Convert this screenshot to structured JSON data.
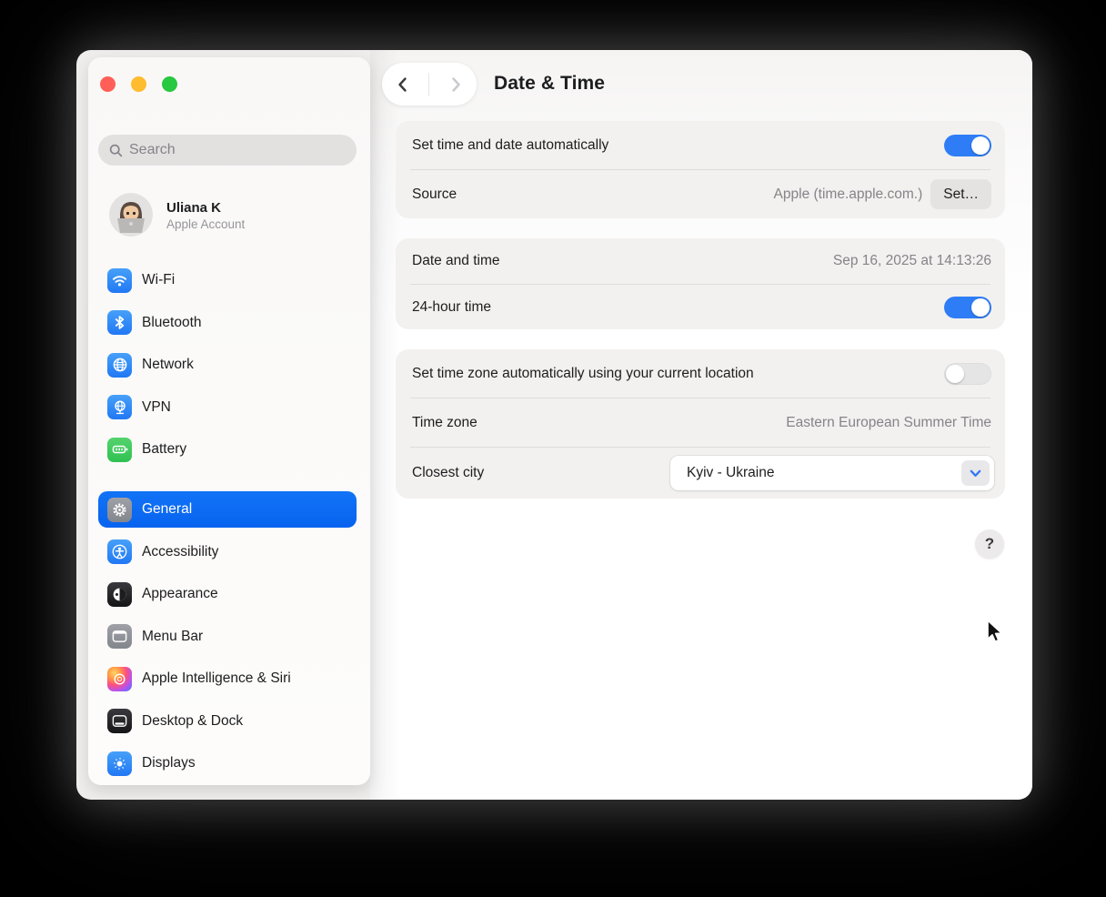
{
  "window": {
    "title": "Date & Time",
    "traffic_lights": [
      "close",
      "minimize",
      "zoom"
    ]
  },
  "sidebar": {
    "search": {
      "placeholder": "Search"
    },
    "profile": {
      "name": "Uliana K",
      "subtitle": "Apple Account"
    },
    "nav_primary": [
      {
        "label": "Wi-Fi",
        "icon": "wifi-icon",
        "color": "#2e86f6"
      },
      {
        "label": "Bluetooth",
        "icon": "bluetooth-icon",
        "color": "#2e86f6"
      },
      {
        "label": "Network",
        "icon": "network-icon",
        "color": "#2e86f6"
      },
      {
        "label": "VPN",
        "icon": "vpn-icon",
        "color": "#2e86f6"
      },
      {
        "label": "Battery",
        "icon": "battery-icon",
        "color": "#34c759"
      }
    ],
    "nav_secondary": [
      {
        "label": "General",
        "icon": "gear-icon",
        "color": "#8e8e93",
        "selected": true
      },
      {
        "label": "Accessibility",
        "icon": "accessibility-icon",
        "color": "#2e86f6",
        "selected": false
      },
      {
        "label": "Appearance",
        "icon": "appearance-icon",
        "color": "#1c1c1e",
        "selected": false
      },
      {
        "label": "Menu Bar",
        "icon": "menu-bar-icon",
        "color": "#8e8e93",
        "selected": false
      },
      {
        "label": "Apple Intelligence & Siri",
        "icon": "apple-intelligence-icon",
        "color": "gradient",
        "selected": false
      },
      {
        "label": "Desktop & Dock",
        "icon": "desktop-dock-icon",
        "color": "#1c1c1e",
        "selected": false
      },
      {
        "label": "Displays",
        "icon": "displays-icon",
        "color": "#2e86f6",
        "selected": false
      }
    ]
  },
  "content": {
    "groups": [
      {
        "rows": [
          {
            "label": "Set time and date automatically",
            "control": "toggle",
            "value": true
          },
          {
            "label": "Source",
            "value_text": "Apple (time.apple.com.)",
            "button_label": "Set…"
          }
        ]
      },
      {
        "rows": [
          {
            "label": "Date and time",
            "value_text": "Sep 16, 2025 at 14:13:26"
          },
          {
            "label": "24-hour time",
            "control": "toggle",
            "value": true
          }
        ]
      },
      {
        "rows": [
          {
            "label": "Set time zone automatically using your current location",
            "control": "toggle",
            "value": false
          },
          {
            "label": "Time zone",
            "value_text": "Eastern European Summer Time"
          },
          {
            "label": "Closest city",
            "dropdown_value": "Kyiv - Ukraine"
          }
        ]
      }
    ],
    "help_label": "?",
    "accent_color": "#2e7df6",
    "selection_color": "#0a6cf5"
  }
}
